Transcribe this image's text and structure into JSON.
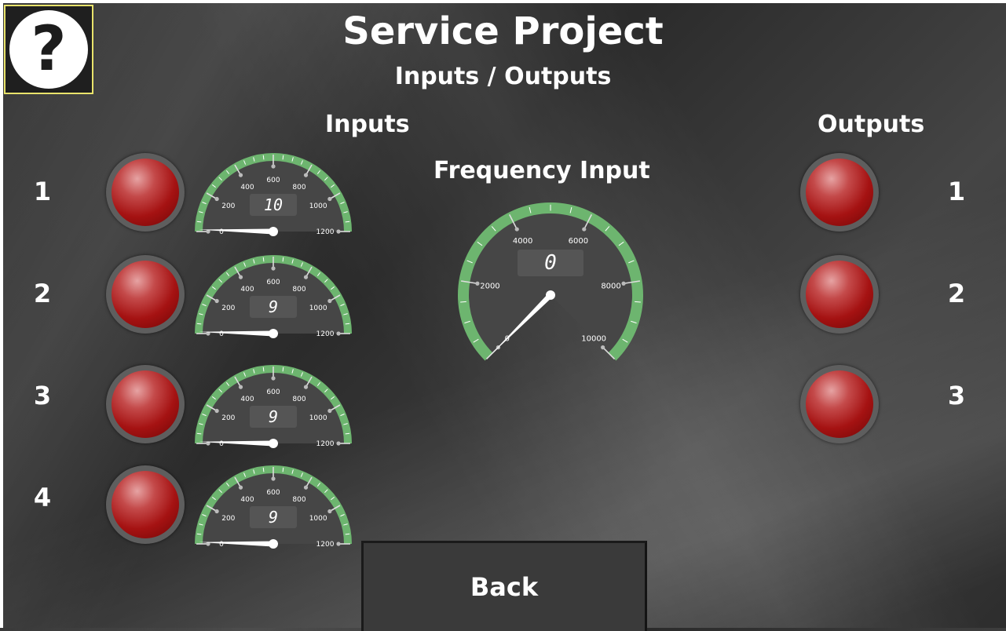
{
  "header": {
    "title": "Service Project",
    "subtitle": "Inputs / Outputs",
    "help_icon": "question-circle-icon",
    "help_glyph": "?"
  },
  "inputs": {
    "label": "Inputs",
    "rows": [
      {
        "number": "1",
        "value": "10"
      },
      {
        "number": "2",
        "value": "9"
      },
      {
        "number": "3",
        "value": "9"
      },
      {
        "number": "4",
        "value": "9"
      }
    ],
    "gauge_labels": [
      "0",
      "200",
      "400",
      "600",
      "800",
      "1000",
      "1200"
    ],
    "gauge_min": 0,
    "gauge_max": 1200
  },
  "frequency": {
    "label": "Frequency Input",
    "value": "0",
    "gauge_labels": [
      "0",
      "2000",
      "4000",
      "6000",
      "8000",
      "10000"
    ],
    "gauge_min": 0,
    "gauge_max": 10000
  },
  "outputs": {
    "label": "Outputs",
    "rows": [
      {
        "number": "1"
      },
      {
        "number": "2"
      },
      {
        "number": "3"
      }
    ]
  },
  "back_button": {
    "label": "Back"
  },
  "colors": {
    "gauge_arc": "#6db56f",
    "gauge_face": "#464646",
    "led_off": "#a51212",
    "help_border": "#e9e36b"
  }
}
